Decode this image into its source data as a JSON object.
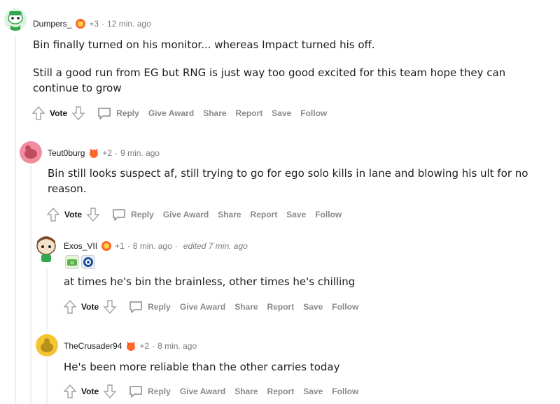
{
  "comments": [
    {
      "username": "Dumpers_",
      "score": "+3",
      "time": "12 min. ago",
      "paragraphs": [
        "Bin finally turned on his monitor... whereas Impact turned his off.",
        "Still a good run from EG but RNG is just way too good excited for this team hope they can continue to grow"
      ]
    },
    {
      "username": "Teut0burg",
      "score": "+2",
      "time": "9 min. ago",
      "paragraphs": [
        "Bin still looks suspect af, still trying to go for ego solo kills in lane and blowing his ult for no reason."
      ]
    },
    {
      "username": "Exos_VII",
      "score": "+1",
      "time": "8 min. ago",
      "edited": "edited 7 min. ago",
      "paragraphs": [
        "at times he's bin the brainless, other times he's chilling"
      ]
    },
    {
      "username": "TheCrusader94",
      "score": "+2",
      "time": "8 min. ago",
      "paragraphs": [
        "He's been more reliable than the other carries today"
      ]
    }
  ],
  "actions": {
    "vote": "Vote",
    "reply": "Reply",
    "give_award": "Give Award",
    "share": "Share",
    "report": "Report",
    "save": "Save",
    "follow": "Follow"
  },
  "separator": "·",
  "icons": {
    "upvote": "up-arrow-icon",
    "downvote": "down-arrow-icon",
    "reply": "speech-bubble-icon",
    "award": "award-icon",
    "avatar": "snoo-avatar"
  },
  "colors": {
    "avatar_1": "#2fa84f",
    "avatar_2": "#f28ca0",
    "avatar_3": "#7a4a2a",
    "avatar_4": "#f5c431",
    "award": "#ff6a2b"
  }
}
